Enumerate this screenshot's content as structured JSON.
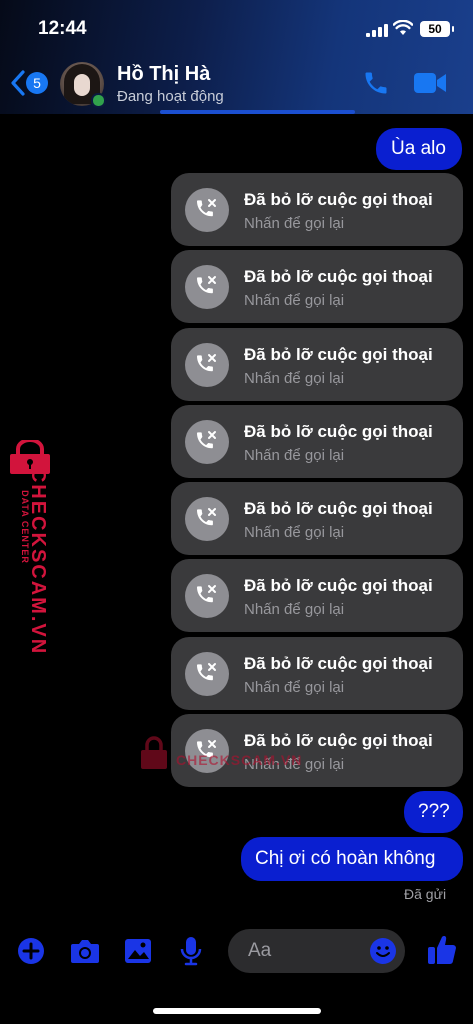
{
  "status_bar": {
    "time": "12:44",
    "battery": "50"
  },
  "header": {
    "unread_count": "5",
    "contact_name": "Hồ Thị Hà",
    "presence": "Đang hoạt động"
  },
  "messages": {
    "outgoing_1": "Ùa alo",
    "missed_calls": [
      {
        "title": "Đã bỏ lỡ cuộc gọi thoại",
        "subtitle": "Nhấn để gọi lại"
      },
      {
        "title": "Đã bỏ lỡ cuộc gọi thoại",
        "subtitle": "Nhấn để gọi lại"
      },
      {
        "title": "Đã bỏ lỡ cuộc gọi thoại",
        "subtitle": "Nhấn để gọi lại"
      },
      {
        "title": "Đã bỏ lỡ cuộc gọi thoại",
        "subtitle": "Nhấn để gọi lại"
      },
      {
        "title": "Đã bỏ lỡ cuộc gọi thoại",
        "subtitle": "Nhấn để gọi lại"
      },
      {
        "title": "Đã bỏ lỡ cuộc gọi thoại",
        "subtitle": "Nhấn để gọi lại"
      },
      {
        "title": "Đã bỏ lỡ cuộc gọi thoại",
        "subtitle": "Nhấn để gọi lại"
      },
      {
        "title": "Đã bỏ lỡ cuộc gọi thoại",
        "subtitle": "Nhấn để gọi lại"
      }
    ],
    "outgoing_2": "???",
    "outgoing_3": "Chị ơi có hoàn không",
    "delivery_status": "Đã gửi"
  },
  "watermark": {
    "brand": "CHECKSCAM.VN",
    "tag": "DATA CENTER"
  },
  "composer": {
    "placeholder": "Aa"
  },
  "colors": {
    "outgoing_bubble": "#0a1fd0",
    "missed_bubble": "#3a3a3c",
    "accent": "#1877f2",
    "online": "#31a24c"
  }
}
